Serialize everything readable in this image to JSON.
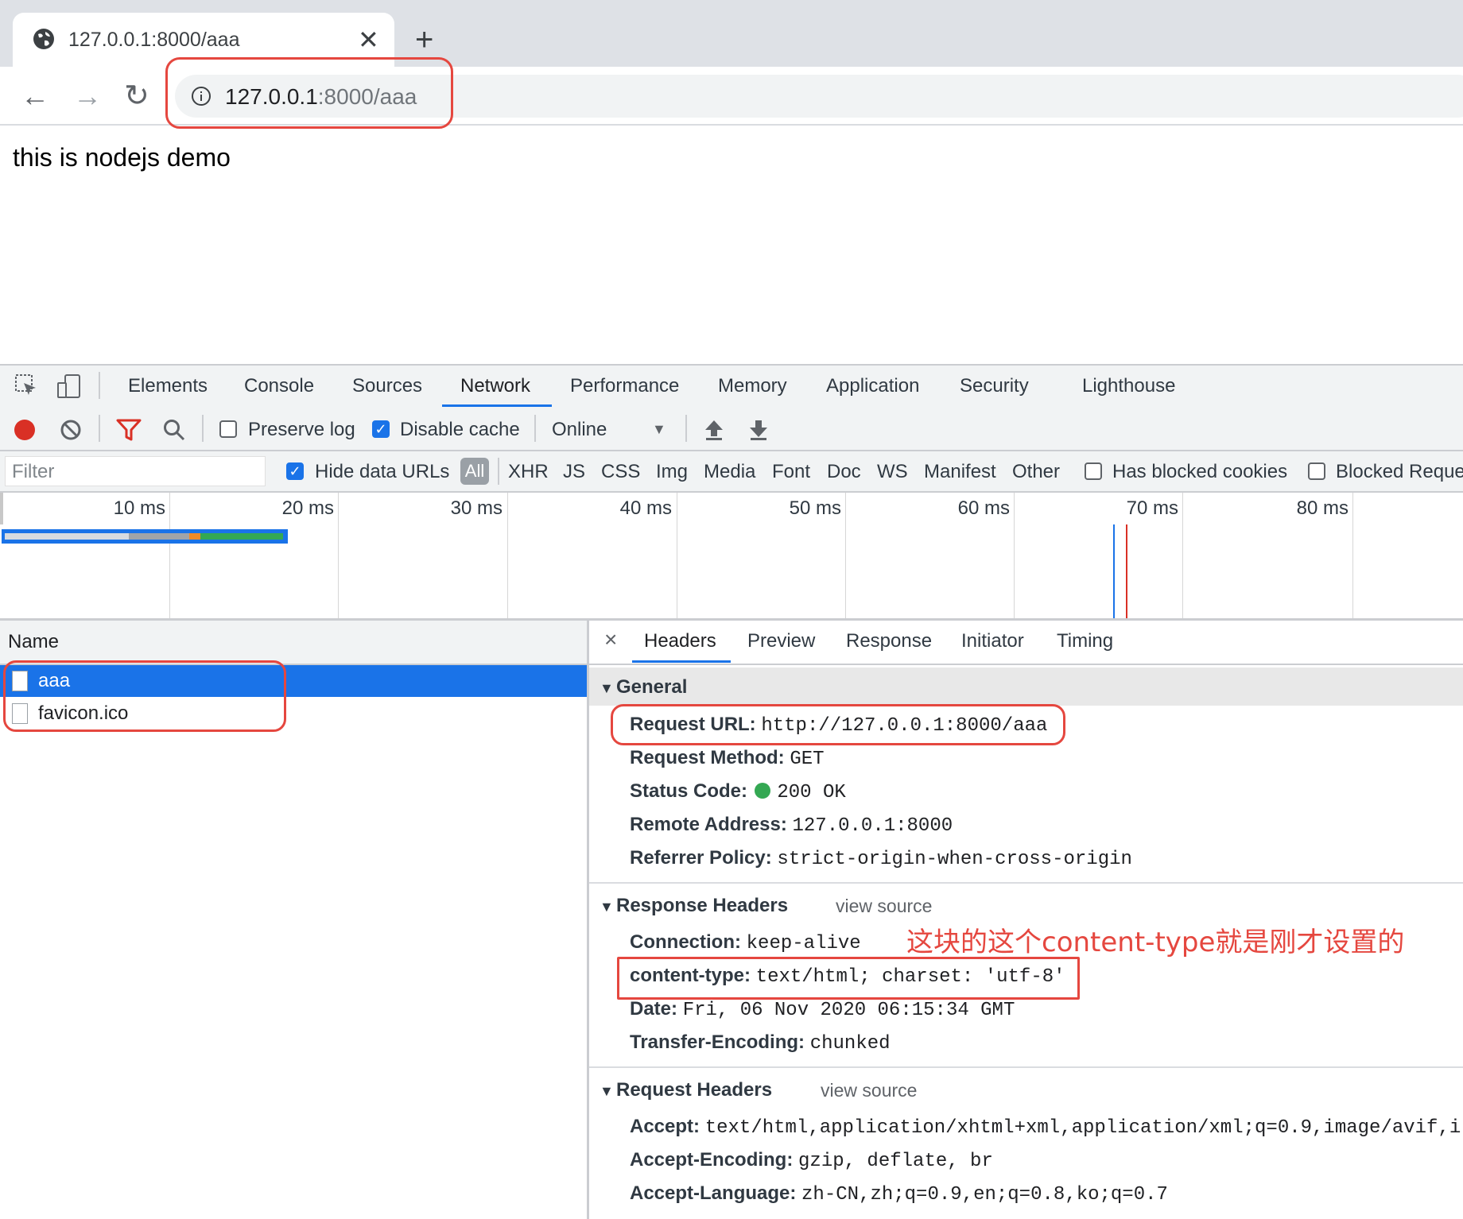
{
  "browser": {
    "tab_title": "127.0.0.1:8000/aaa",
    "tab_close": "✕",
    "new_tab": "+",
    "url_host": "127.0.0.1",
    "url_rest": ":8000/aaa"
  },
  "page": {
    "body_text": "this is nodejs demo"
  },
  "devtools": {
    "tabs": [
      "Elements",
      "Console",
      "Sources",
      "Network",
      "Performance",
      "Memory",
      "Application",
      "Security",
      "Lighthouse"
    ],
    "active_tab": "Network",
    "network_toolbar": {
      "preserve_log": "Preserve log",
      "preserve_log_checked": false,
      "disable_cache": "Disable cache",
      "disable_cache_checked": true,
      "throttle": "Online"
    },
    "filter_bar": {
      "placeholder": "Filter",
      "hide_data_urls": "Hide data URLs",
      "hide_data_urls_checked": true,
      "types": [
        "All",
        "XHR",
        "JS",
        "CSS",
        "Img",
        "Media",
        "Font",
        "Doc",
        "WS",
        "Manifest",
        "Other"
      ],
      "active_type": "All",
      "has_blocked_cookies": "Has blocked cookies",
      "blocked_requests": "Blocked Reque"
    },
    "overview": {
      "ticks": [
        "10 ms",
        "20 ms",
        "30 ms",
        "40 ms",
        "50 ms",
        "60 ms",
        "70 ms",
        "80 ms"
      ]
    },
    "requests": {
      "header": "Name",
      "rows": [
        "aaa",
        "favicon.ico"
      ],
      "selected": "aaa"
    },
    "detail": {
      "close": "×",
      "tabs": [
        "Headers",
        "Preview",
        "Response",
        "Initiator",
        "Timing"
      ],
      "active_tab": "Headers",
      "general": {
        "title": "General",
        "rows": [
          {
            "key": "Request URL:",
            "value": "http://127.0.0.1:8000/aaa"
          },
          {
            "key": "Request Method:",
            "value": "GET"
          },
          {
            "key": "Status Code:",
            "value": "200 OK",
            "status_color": "#34a853"
          },
          {
            "key": "Remote Address:",
            "value": "127.0.0.1:8000"
          },
          {
            "key": "Referrer Policy:",
            "value": "strict-origin-when-cross-origin"
          }
        ]
      },
      "response_headers": {
        "title": "Response Headers",
        "view_source": "view source",
        "rows": [
          {
            "key": "Connection:",
            "value": "keep-alive"
          },
          {
            "key": "content-type:",
            "value": "text/html; charset: 'utf-8'"
          },
          {
            "key": "Date:",
            "value": "Fri, 06 Nov 2020 06:15:34 GMT"
          },
          {
            "key": "Transfer-Encoding:",
            "value": "chunked"
          }
        ]
      },
      "request_headers": {
        "title": "Request Headers",
        "view_source": "view source",
        "rows": [
          {
            "key": "Accept:",
            "value": "text/html,application/xhtml+xml,application/xml;q=0.9,image/avif,i"
          },
          {
            "key": "Accept-Encoding:",
            "value": "gzip, deflate, br"
          },
          {
            "key": "Accept-Language:",
            "value": "zh-CN,zh;q=0.9,en;q=0.8,ko;q=0.7"
          }
        ]
      }
    }
  },
  "annotation": {
    "text": "这块的这个content-type就是刚才设置的",
    "color": "#e5473f"
  },
  "colors": {
    "accent": "#1a73e8",
    "annotation_red": "#e5473f",
    "record_red": "#d93025"
  }
}
